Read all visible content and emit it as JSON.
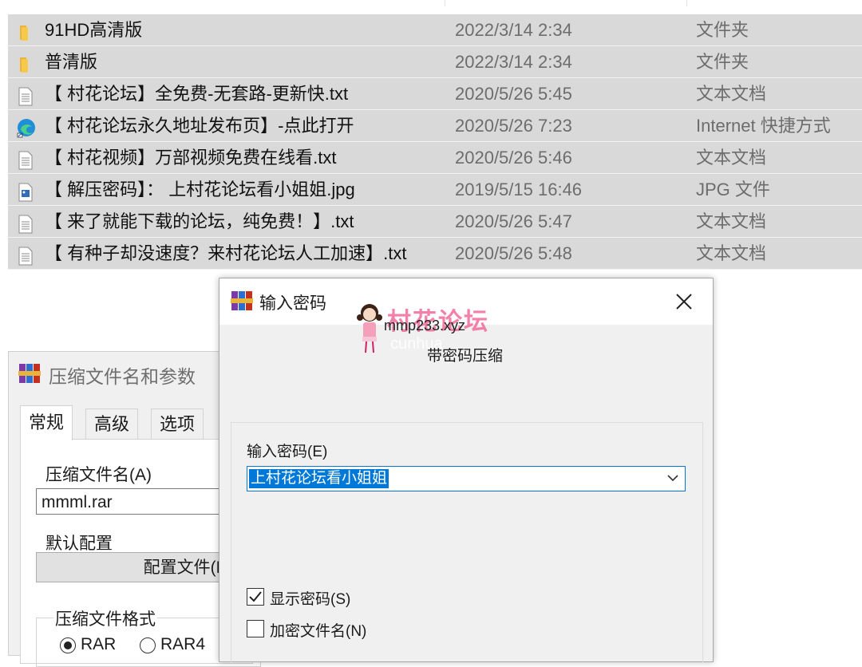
{
  "file_list": {
    "rows": [
      {
        "name": "91HD高清版",
        "date": "2022/3/14 2:34",
        "type": "文件夹",
        "icon": "folder-icon"
      },
      {
        "name": "普清版",
        "date": "2022/3/14 2:34",
        "type": "文件夹",
        "icon": "folder-icon"
      },
      {
        "name": "【 村花论坛】全免费-无套路-更新快.txt",
        "date": "2020/5/26 5:45",
        "type": "文本文档",
        "icon": "text-file-icon"
      },
      {
        "name": "【 村花论坛永久地址发布页】-点此打开",
        "date": "2020/5/26 7:23",
        "type": "Internet 快捷方式",
        "icon": "edge-shortcut-icon"
      },
      {
        "name": "【 村花视频】万部视频免费在线看.txt",
        "date": "2020/5/26 5:46",
        "type": "文本文档",
        "icon": "text-file-icon"
      },
      {
        "name": "【 解压密码】： 上村花论坛看小姐姐.jpg",
        "date": "2019/5/15 16:46",
        "type": "JPG 文件",
        "icon": "image-file-icon"
      },
      {
        "name": "【 来了就能下载的论坛，纯免费！】.txt",
        "date": "2020/5/26 5:47",
        "type": "文本文档",
        "icon": "text-file-icon"
      },
      {
        "name": "【 有种子却没速度？来村花论坛人工加速】.txt",
        "date": "2020/5/26 5:48",
        "type": "文本文档",
        "icon": "text-file-icon"
      }
    ]
  },
  "archive_dialog": {
    "title": "压缩文件名和参数",
    "tabs": [
      "常规",
      "高级",
      "选项"
    ],
    "archive_name_label": "压缩文件名(A)",
    "archive_name_value": "mmml.rar",
    "default_profile_label": "默认配置",
    "profiles_button": "配置文件(F)...",
    "format_label": "压缩文件格式",
    "format_options": [
      "RAR",
      "RAR4"
    ],
    "format_selected": "RAR"
  },
  "password_dialog": {
    "title": "输入密码",
    "subtitle": "带密码压缩",
    "password_label": "输入密码(E)",
    "password_value": "上村花论坛看小姐姐",
    "show_password_label": "显示密码(S)",
    "show_password_checked": true,
    "encrypt_names_label": "加密文件名(N)",
    "encrypt_names_checked": false
  },
  "watermark": {
    "brand": "村花论坛",
    "url": "mmp233.xyz",
    "faint": "cunhua"
  },
  "colors": {
    "selection": "#d9d9d9",
    "accent": "#0078d7",
    "watermark_pink": "#f26b9a"
  }
}
